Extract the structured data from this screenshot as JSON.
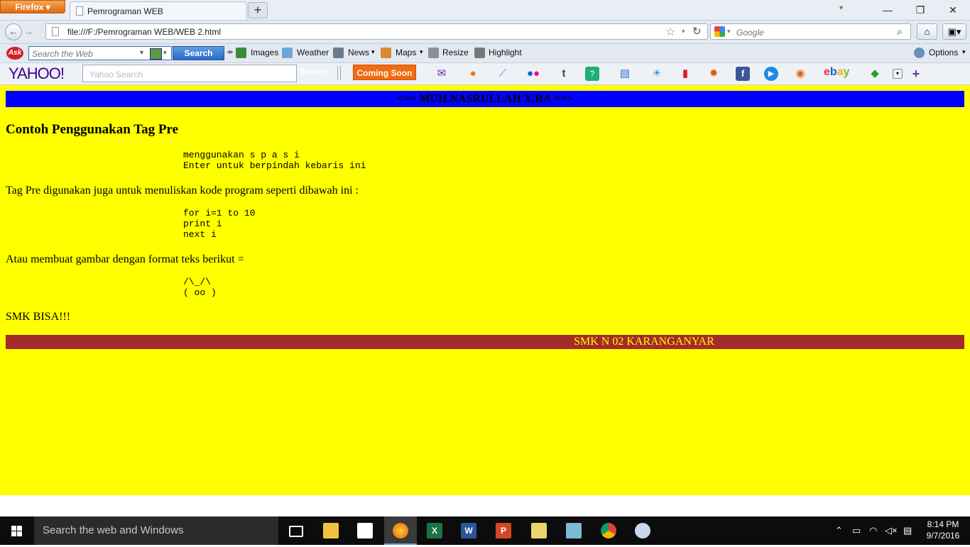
{
  "browser": {
    "app_button": "Firefox",
    "tab_title": "Pemrograman WEB",
    "new_tab": "+",
    "url": "file:///F:/Pemrograman WEB/WEB 2.html",
    "search_placeholder": "Google"
  },
  "ask_toolbar": {
    "logo": "Ask",
    "placeholder": "Search the Web",
    "search_button": "Search",
    "items": [
      "Images",
      "Weather",
      "News",
      "Maps",
      "Resize",
      "Highlight"
    ],
    "options": "Options"
  },
  "yahoo_toolbar": {
    "logo": "YAHOO!",
    "placeholder": "Yahoo Search",
    "search_button": "Search",
    "coming_soon": "Coming Soon",
    "ebay": "ebay"
  },
  "page": {
    "top_banner": "<== MUH.NASRULLAH X.RA ==>",
    "heading": "Contoh Penggunakan Tag Pre",
    "pre1": "menggunakan s p a s i\nEnter untuk berpindah kebaris ini",
    "para1": "Tag Pre digunakan juga untuk menuliskan kode program seperti dibawah ini :",
    "pre2": "for i=1 to 10\nprint i\nnext i",
    "para2": "Atau membuat gambar dengan format teks berikut =",
    "pre3": "/\\_/\\\n( oo )",
    "para3": "SMK BISA!!!",
    "footer_banner": "SMK N 02 KARANGANYAR"
  },
  "taskbar": {
    "search_placeholder": "Search the web and Windows",
    "time": "8:14 PM",
    "date": "9/7/2016"
  }
}
